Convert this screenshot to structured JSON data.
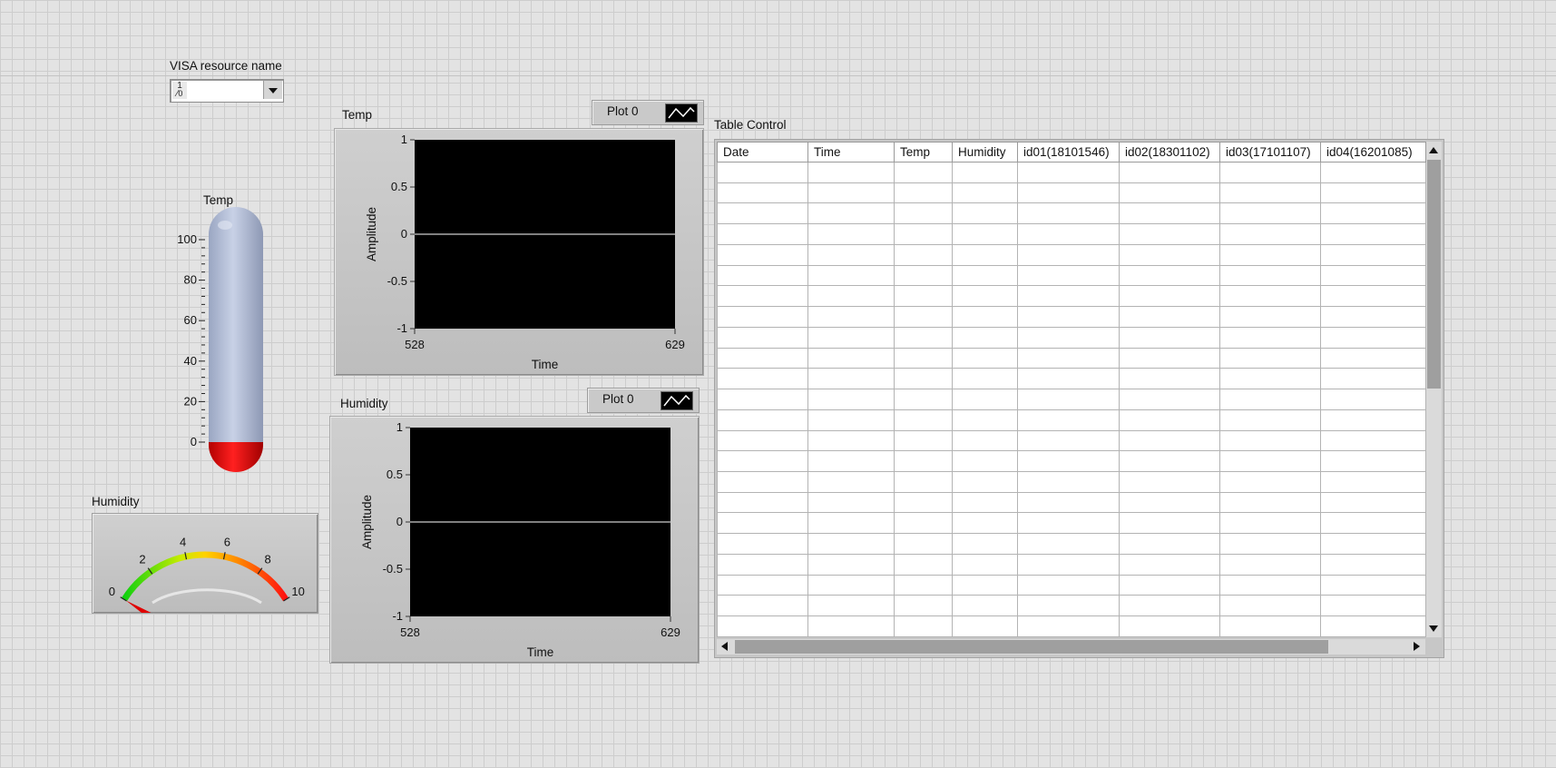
{
  "visa": {
    "label": "VISA resource name",
    "icon_text": "I/O",
    "value": ""
  },
  "thermometer": {
    "label": "Temp",
    "ticks": [
      "100",
      "80",
      "60",
      "40",
      "20",
      "0"
    ],
    "value": 0,
    "fill_color": "#e00000"
  },
  "gauge": {
    "label": "Humidity",
    "ticks": [
      "0",
      "2",
      "4",
      "6",
      "8",
      "10"
    ],
    "value": 0
  },
  "temp_graph": {
    "label": "Temp",
    "legend": "Plot 0",
    "y_label": "Amplitude",
    "x_label": "Time",
    "y_ticks": [
      "1",
      "0.5",
      "0",
      "-0.5",
      "-1"
    ],
    "x_ticks": [
      "528",
      "629"
    ]
  },
  "humidity_graph": {
    "label": "Humidity",
    "legend": "Plot 0",
    "y_label": "Amplitude",
    "x_label": "Time",
    "y_ticks": [
      "1",
      "0.5",
      "0",
      "-0.5",
      "-1"
    ],
    "x_ticks": [
      "528",
      "629"
    ]
  },
  "table": {
    "label": "Table Control",
    "columns": [
      "Date",
      "Time",
      "Temp",
      "Humidity",
      "id01(18101546)",
      "id02(18301102)",
      "id03(17101107)",
      "id04(16201085)"
    ]
  },
  "colors": {
    "plot_bg": "#000000",
    "plot_line": "#ffffff",
    "thermo_body": "#b4bed6"
  }
}
